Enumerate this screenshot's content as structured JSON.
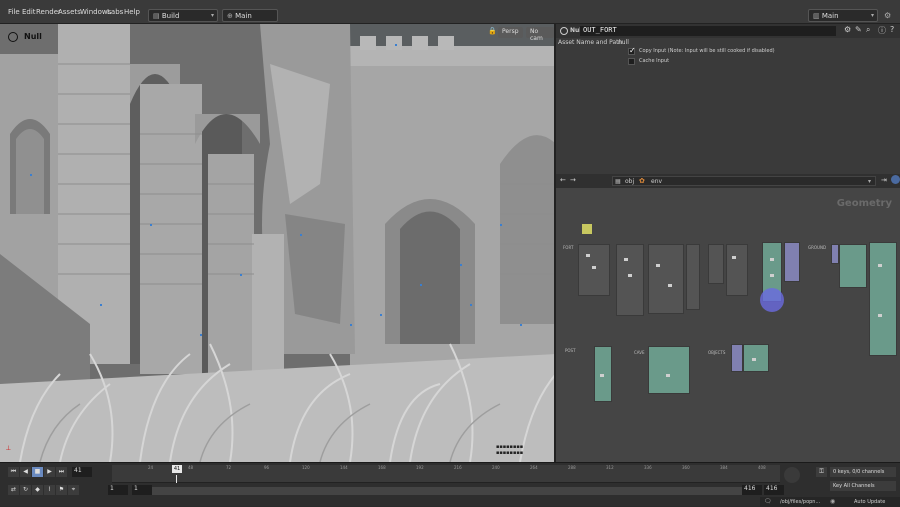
{
  "menubar": {
    "items": [
      "File",
      "Edit",
      "Render",
      "Assets",
      "Windows",
      "Labs",
      "Help"
    ],
    "desktop_left": "Build",
    "desktop_main": "Main",
    "desktop_right": "Main"
  },
  "viewport": {
    "title": "Null",
    "camera_label": "Persp",
    "cam_label": "No cam"
  },
  "parms": {
    "node_type": "Null",
    "node_name": "OUT_FORT",
    "asset_label": "Asset Name and Path",
    "asset_value": "null",
    "copy_input_label": "Copy Input (Note: Input will be still cooked if disabled)",
    "copy_input_checked": true,
    "cache_input_label": "Cache Input",
    "cache_input_checked": false
  },
  "network": {
    "obj_label": "obj",
    "env_label": "env",
    "context_label": "Geometry",
    "group_labels": [
      "FORT",
      "GROUND",
      "POST",
      "CAVE",
      "OBJECTS"
    ]
  },
  "timeline": {
    "current_frame": "41",
    "frame_field": "41",
    "tick_labels": [
      "24",
      "48",
      "72",
      "96",
      "120",
      "144",
      "168",
      "192",
      "216",
      "240",
      "264",
      "288",
      "312",
      "336",
      "360",
      "384",
      "408"
    ],
    "start_frame": "1",
    "start_frame2": "1",
    "end_frame": "416",
    "end_frame2": "416",
    "keys_label": "0 keys, 0/0 channels",
    "key_all_label": "Key All Channels",
    "path_label": "/obj/files/popn...",
    "auto_update_label": "Auto Update"
  }
}
